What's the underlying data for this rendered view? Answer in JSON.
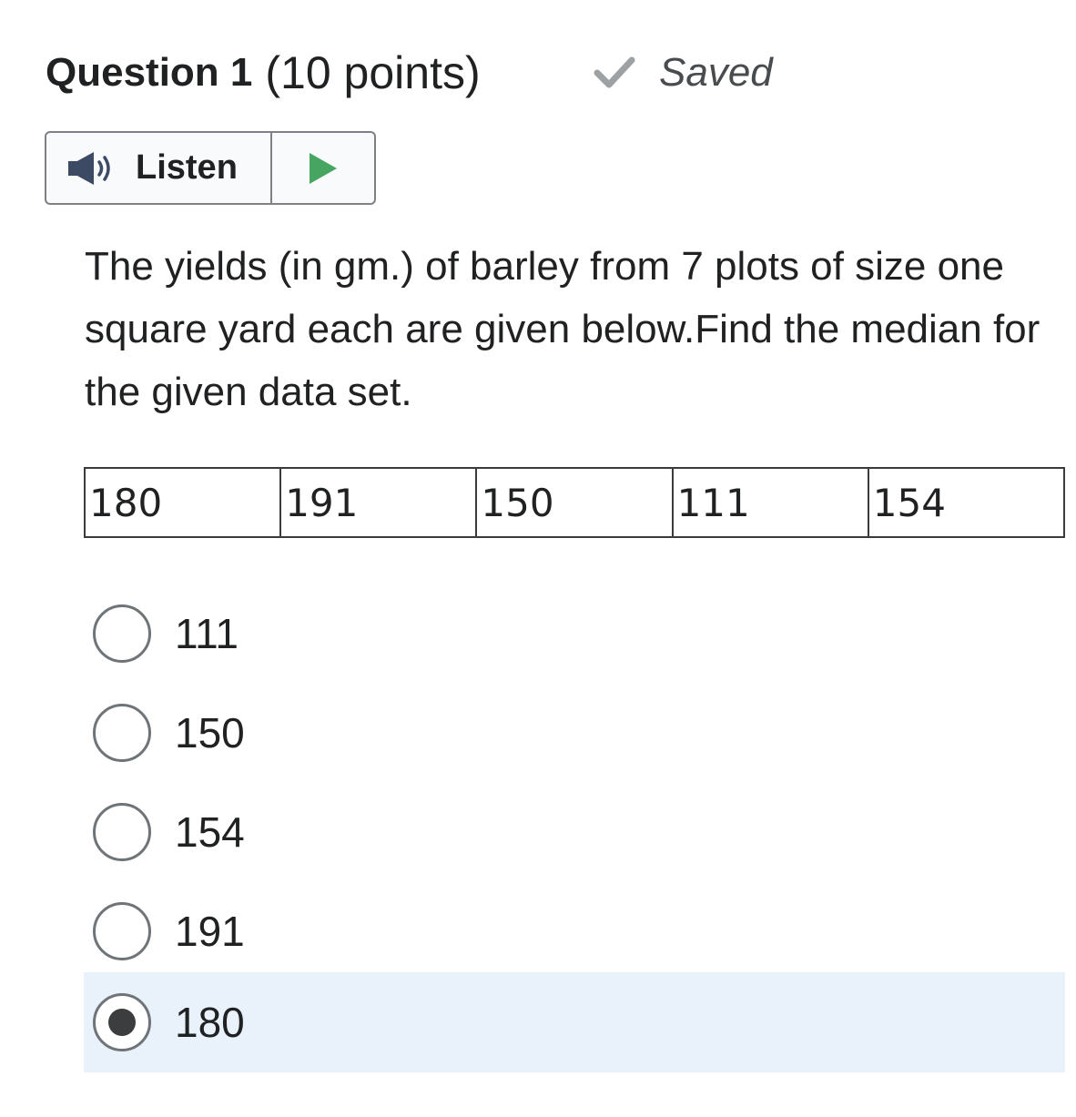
{
  "question": {
    "title": "Question 1",
    "points": "(10 points)",
    "status_icon": "check-icon",
    "status_text": "Saved",
    "status_color": "#9ea1a3"
  },
  "listen": {
    "speaker_icon": "speaker-icon",
    "label": "Listen",
    "play_icon": "play-icon",
    "play_color": "#46a661"
  },
  "body": {
    "text": "The yields (in gm.) of barley from 7 plots of size one square yard each are given below.Find the median for the given data set."
  },
  "data_table": {
    "cells": [
      "180",
      "191",
      "150",
      "111",
      "154"
    ]
  },
  "options": [
    {
      "label": "111",
      "selected": false
    },
    {
      "label": "150",
      "selected": false
    },
    {
      "label": "154",
      "selected": false
    },
    {
      "label": "191",
      "selected": false
    },
    {
      "label": "180",
      "selected": true
    }
  ],
  "colors": {
    "selected_background": "#e9f1fb",
    "text": "#202122",
    "border": "#7d8185"
  }
}
